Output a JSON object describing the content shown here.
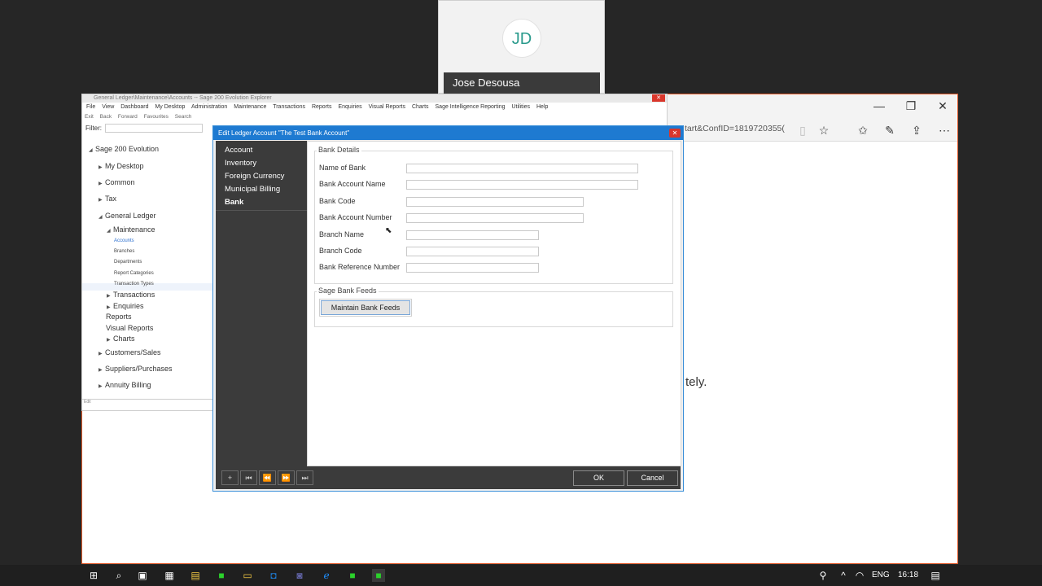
{
  "participant": {
    "initials": "JD",
    "name": "Jose Desousa"
  },
  "browser": {
    "address_tail": "tart&ConfID=1819720355(",
    "body_text": "tely.",
    "controls": {
      "minimize": "—",
      "restore": "❐",
      "close": "✕"
    }
  },
  "sage": {
    "title": "General Ledger\\Maintenance\\Accounts -- Sage 200 Evolution Explorer",
    "menu": [
      "File",
      "View",
      "Dashboard",
      "My Desktop",
      "Administration",
      "Maintenance",
      "Transactions",
      "Reports",
      "Enquiries",
      "Visual Reports",
      "Charts",
      "Sage Intelligence Reporting",
      "Utilities",
      "Help"
    ],
    "tools": {
      "exit": "Exit",
      "back": "Back",
      "forward": "Forward",
      "favourites": "Favourites",
      "search": "Search"
    },
    "filter_label": "Filter:",
    "tree": {
      "root": "Sage 200 Evolution",
      "my_desktop": "My Desktop",
      "common": "Common",
      "tax": "Tax",
      "general_ledger": "General Ledger",
      "maintenance": "Maintenance",
      "accounts": "Accounts",
      "branches": "Branches",
      "departments": "Departments",
      "report_categories": "Report Categories",
      "transaction_types": "Transaction Types",
      "transactions": "Transactions",
      "enquiries": "Enquiries",
      "reports": "Reports",
      "visual_reports": "Visual Reports",
      "charts": "Charts",
      "customers_sales": "Customers/Sales",
      "suppliers_purchases": "Suppliers/Purchases",
      "annuity_billing": "Annuity Billing"
    },
    "status": "Edit"
  },
  "dialog": {
    "title": "Edit Ledger Account \"The Test Bank Account\"",
    "side_items": [
      "Account",
      "Inventory",
      "Foreign Currency",
      "Municipal Billing",
      "Bank"
    ],
    "bank_details": {
      "label": "Bank Details",
      "fields": {
        "name_of_bank": "Name of Bank",
        "bank_account_name": "Bank Account Name",
        "bank_code": "Bank Code",
        "bank_account_number": "Bank Account Number",
        "branch_name": "Branch Name",
        "branch_code": "Branch Code",
        "bank_reference_number": "Bank Reference Number"
      }
    },
    "feeds": {
      "label": "Sage Bank Feeds",
      "button": "Maintain Bank Feeds"
    },
    "footer": {
      "add": "+",
      "first": "⏮",
      "prev": "⏪",
      "next": "⏩",
      "last": "⏭",
      "ok": "OK",
      "cancel": "Cancel"
    }
  },
  "taskbar": {
    "lang": "ENG",
    "time": "16:18"
  }
}
